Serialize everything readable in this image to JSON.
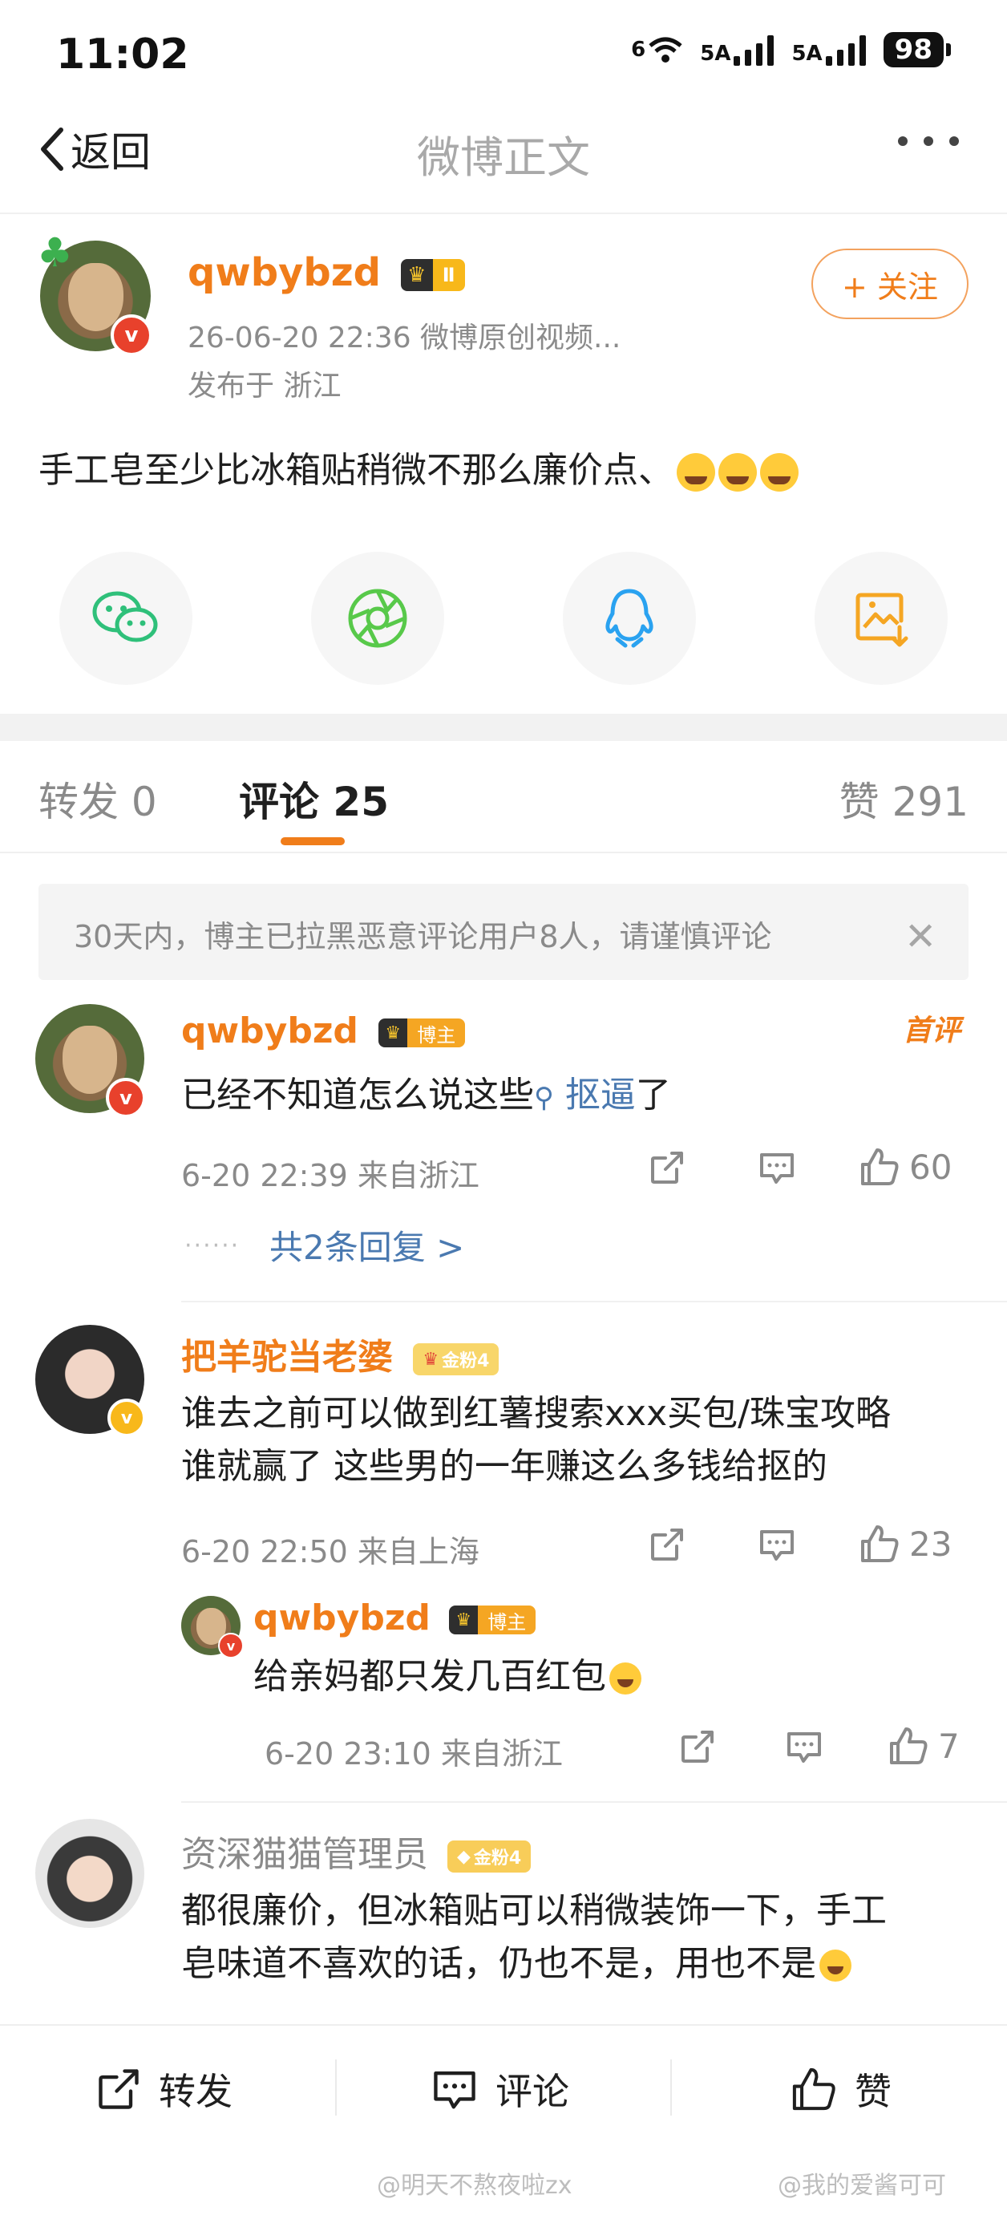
{
  "status": {
    "time": "11:02",
    "net1": "6",
    "net2": "5A",
    "net3": "5A",
    "battery": "98"
  },
  "nav": {
    "back_label": "返回",
    "title": "微博正文"
  },
  "post": {
    "author": "qwbybzd",
    "badge_level": "Ⅱ",
    "meta": "26-06-20 22:36  微博原创视频...",
    "location": "发布于 浙江",
    "follow_label": "+ 关注",
    "text": "手工皂至少比冰箱贴稍微不那么廉价点、"
  },
  "share": [
    "wechat-icon",
    "moments-icon",
    "qq-icon",
    "save-image-icon"
  ],
  "tabs": {
    "repost": "转发 0",
    "comments": "评论 25",
    "likes": "赞 291"
  },
  "notice": "30天内，博主已拉黑恶意评论用户8人，请谨慎评论",
  "comments": [
    {
      "name": "qwbybzd",
      "tag": "博主",
      "first_tag": "首评",
      "text": "已经不知道怎么说这些",
      "search_term": "抠逼",
      "text_tail": "了",
      "meta": "6-20 22:39 来自浙江",
      "likes": "60",
      "replies_link": "共2条回复 >"
    },
    {
      "name": "把羊驼当老婆",
      "tag": "金粉4",
      "text1": "谁去之前可以做到红薯搜索xxx买包/珠宝攻略",
      "text2": "谁就赢了 这些男的一年赚这么多钱给抠的",
      "meta": "6-20 22:50 来自上海",
      "likes": "23",
      "reply": {
        "name": "qwbybzd",
        "tag": "博主",
        "text": "给亲妈都只发几百红包",
        "meta": "6-20 23:10 来自浙江",
        "likes": "7"
      }
    },
    {
      "name": "资深猫猫管理员",
      "tag": "金粉4",
      "text1": "都很廉价，但冰箱贴可以稍微装饰一下，手工",
      "text2": "皂味道不喜欢的话，仍也不是，用也不是"
    }
  ],
  "bottom": {
    "repost": "转发",
    "comment": "评论",
    "like": "赞"
  },
  "watermarks": [
    "@明天不熬夜啦zx",
    "@我的爱酱可可"
  ],
  "colors": {
    "accent": "#f07d1a",
    "link": "#4a79b0",
    "muted": "#8a8a8a"
  }
}
